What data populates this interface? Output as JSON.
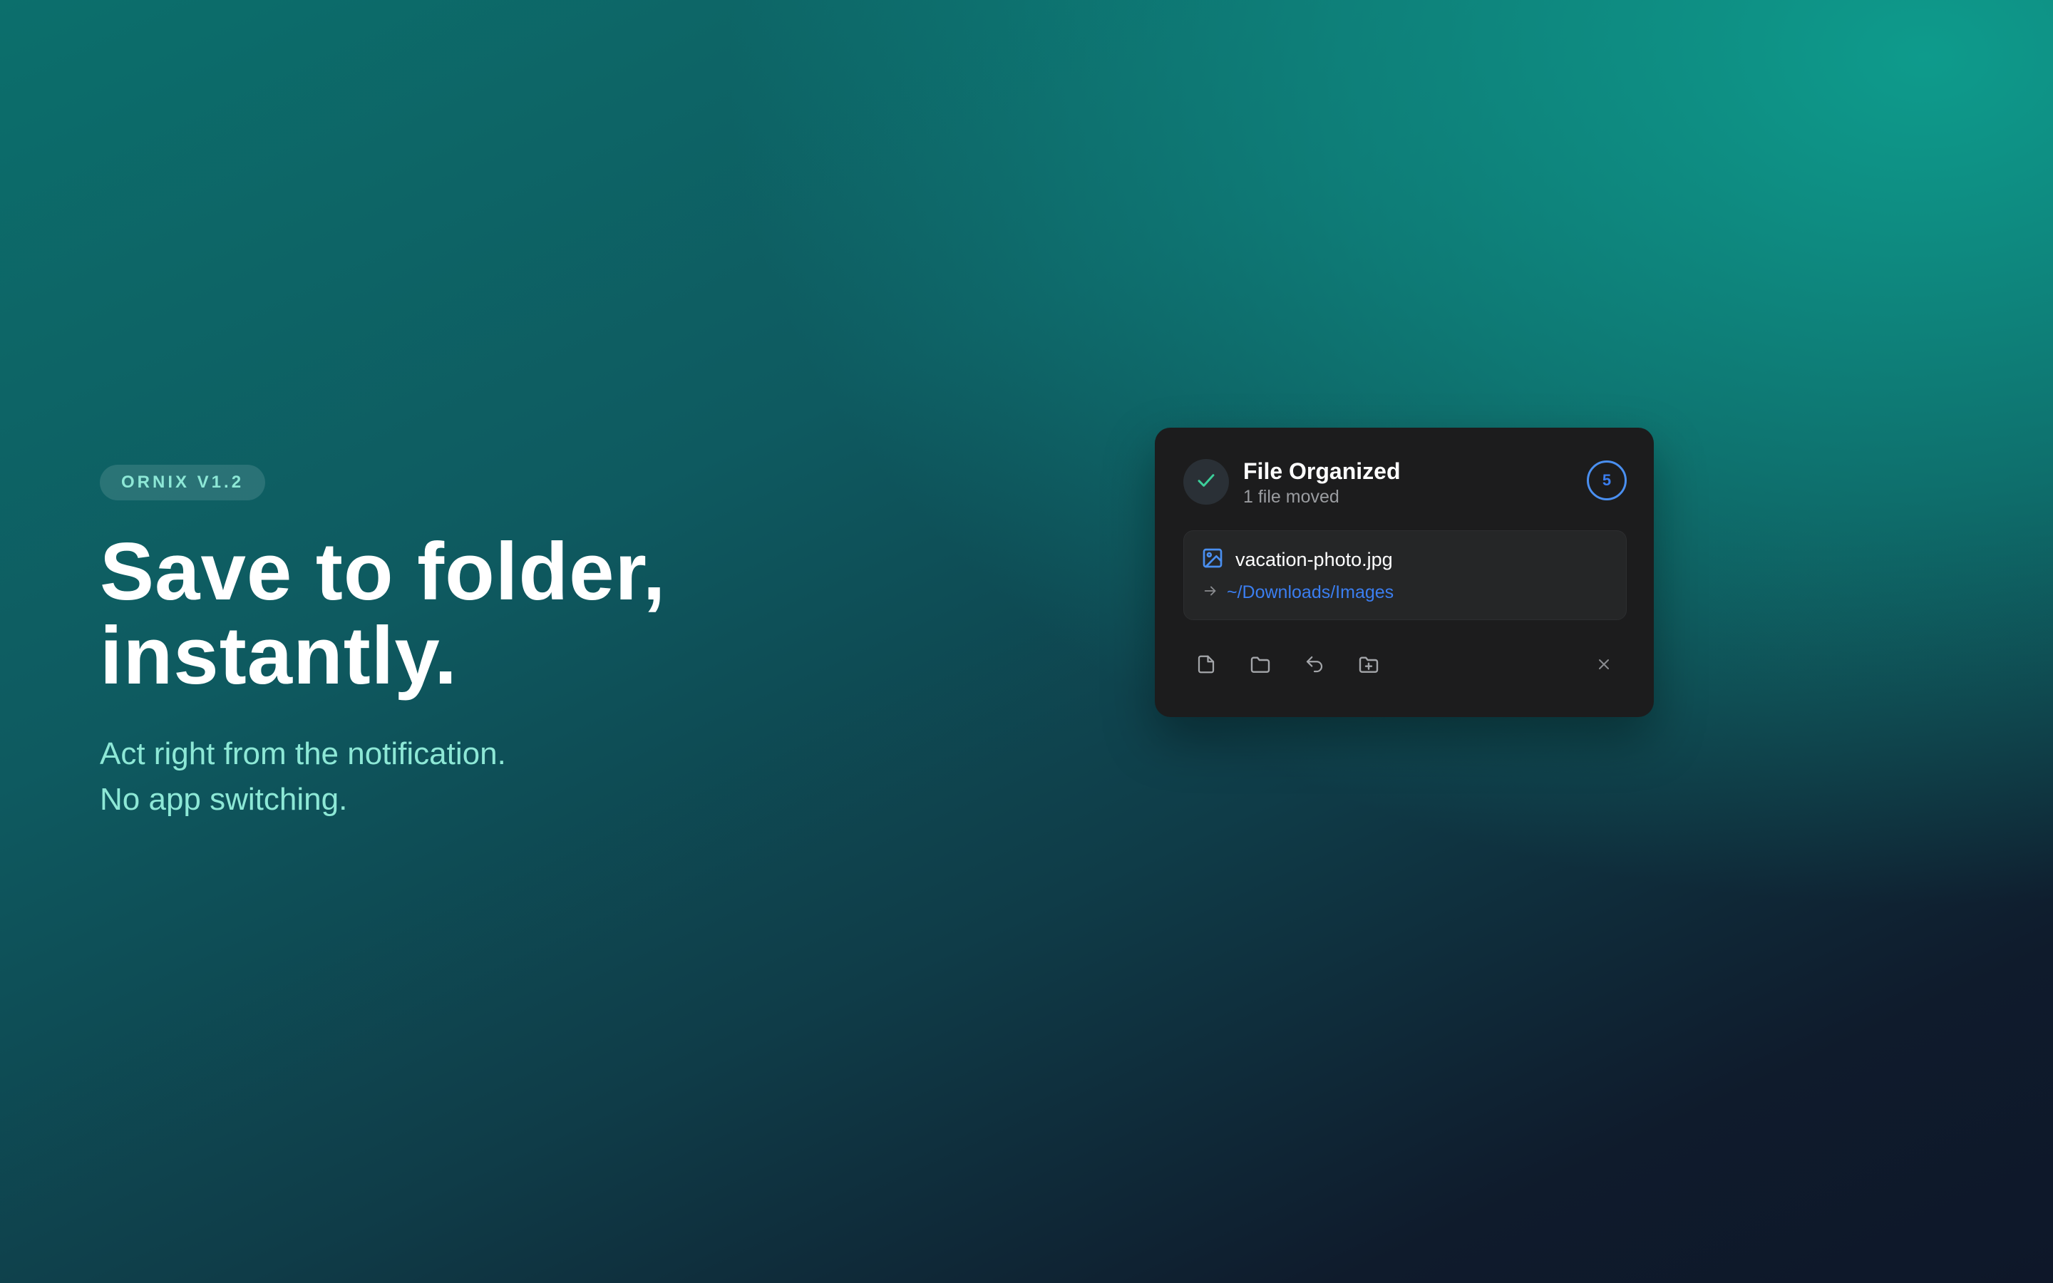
{
  "hero": {
    "badge": "ORNIX V1.2",
    "headline_line1": "Save to folder,",
    "headline_line2": "instantly.",
    "sub_line1": "Act right from the notification.",
    "sub_line2": "No app switching."
  },
  "notification": {
    "status_icon": "check-icon",
    "title": "File Organized",
    "subtitle": "1 file moved",
    "count": "5",
    "file": {
      "icon": "image-file-icon",
      "name": "vacation-photo.jpg",
      "arrow_icon": "arrow-right-icon",
      "destination": "~/Downloads/Images"
    },
    "actions": [
      {
        "icon": "file-icon"
      },
      {
        "icon": "folder-icon"
      },
      {
        "icon": "undo-icon"
      },
      {
        "icon": "folder-plus-icon"
      }
    ],
    "close_icon": "close-icon"
  },
  "colors": {
    "accent_blue": "#3b7ef0",
    "accent_teal": "#8de8d6",
    "check_green": "#3ccf9a",
    "card_bg": "#1c1c1d"
  }
}
